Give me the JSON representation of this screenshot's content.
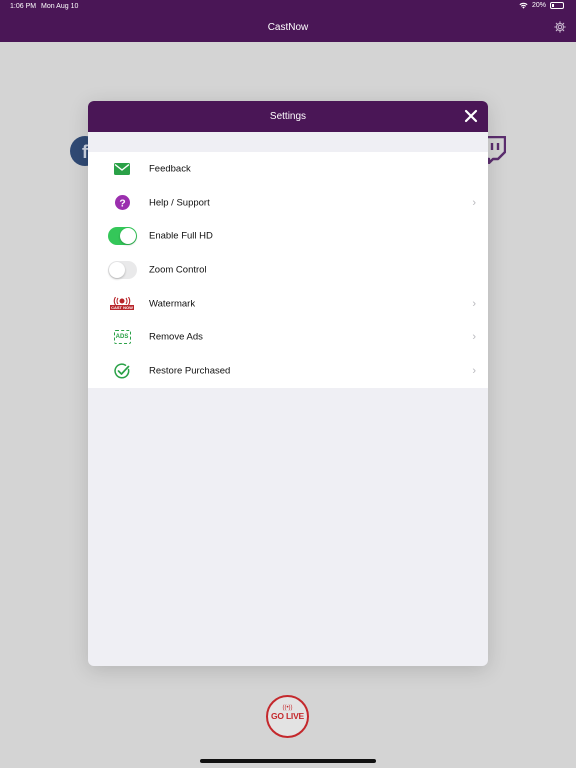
{
  "status_bar": {
    "time": "1:06 PM",
    "date": "Mon Aug 10",
    "battery": "20%",
    "battery_level": 0.2
  },
  "nav": {
    "title": "CastNow"
  },
  "background": {
    "golive_label": "GO LIVE",
    "facebook_letter": "f"
  },
  "modal": {
    "title": "Settings",
    "rows": [
      {
        "label": "Feedback",
        "icon": "envelope-icon",
        "accessory": "none"
      },
      {
        "label": "Help / Support",
        "icon": "question-icon",
        "accessory": "chevron"
      },
      {
        "label": "Enable Full HD",
        "icon": "toggle",
        "toggle_on": true,
        "accessory": "none"
      },
      {
        "label": "Zoom Control",
        "icon": "toggle",
        "toggle_on": false,
        "accessory": "none"
      },
      {
        "label": "Watermark",
        "icon": "castnow-logo-icon",
        "icon_text": "CAST NOW",
        "accessory": "chevron"
      },
      {
        "label": "Remove Ads",
        "icon": "ads-icon",
        "icon_text": "ADS",
        "accessory": "chevron"
      },
      {
        "label": "Restore Purchased",
        "icon": "check-circle-icon",
        "accessory": "chevron"
      }
    ]
  },
  "colors": {
    "brand_purple": "#4a1656",
    "toggle_on": "#34c759",
    "green_icon": "#2aa147",
    "help_purple": "#9b2fae",
    "golive_red": "#c4282c"
  }
}
